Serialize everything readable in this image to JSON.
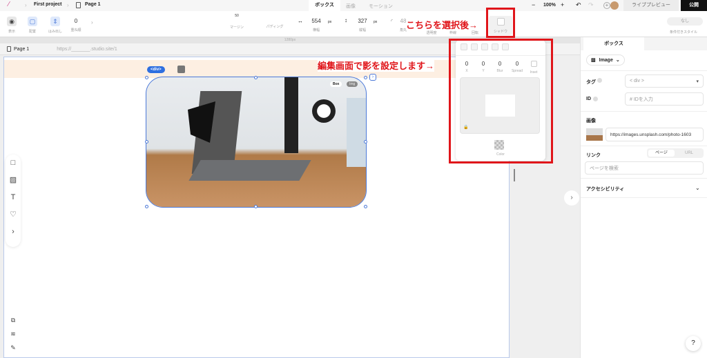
{
  "topbar": {
    "project": "First project",
    "page": "Page 1",
    "tabs": [
      "ボックス",
      "画像",
      "モーション"
    ],
    "zoom": "100%",
    "preview": "ライブプレビュー",
    "publish": "公開"
  },
  "toolbar": {
    "display": "表示",
    "layout": "配置",
    "overflow": "はみ出し",
    "zorder_value": "0",
    "zorder": "重ね順",
    "margin_value": "50",
    "margin": "マージン",
    "padding": "パディング",
    "width_value": "554",
    "width_unit": "px",
    "width": "横幅",
    "height_value": "327",
    "height_unit": "px",
    "height": "縦幅",
    "radius_value": "48",
    "radius": "角丸",
    "opacity": "透明度",
    "border": "枠線",
    "rotate": "回転",
    "shadow": "シャドウ",
    "cond_value": "なし",
    "cond": "条件付きスタイル"
  },
  "ruler": "1280px",
  "pagebar": {
    "page": "Page 1",
    "url": "https://_______.studio.site/1"
  },
  "canvas": {
    "tag_label": "<div>",
    "toggle": [
      "Box",
      "Img"
    ]
  },
  "popover": {
    "values": [
      {
        "v": "0",
        "l": "X"
      },
      {
        "v": "0",
        "l": "Y"
      },
      {
        "v": "0",
        "l": "Blur"
      },
      {
        "v": "0",
        "l": "Spread"
      }
    ],
    "inset": "Inset",
    "color": "Color"
  },
  "annotations": {
    "a1": "こちらを選択後→",
    "a2": "編集画面で影を設定します→"
  },
  "rpanel": {
    "tab": "ボックス",
    "type": "Image",
    "tag_label": "タグ",
    "tag_value": "< div >",
    "id_label": "ID",
    "id_placeholder": "# IDを入力",
    "image_label": "画像",
    "image_url": "https://images.unsplash.com/photo-1603",
    "link_label": "リンク",
    "link_tabs": [
      "ページ",
      "URL"
    ],
    "link_placeholder": "ページを検索",
    "a11y": "アクセシビリティ"
  },
  "help": "?"
}
